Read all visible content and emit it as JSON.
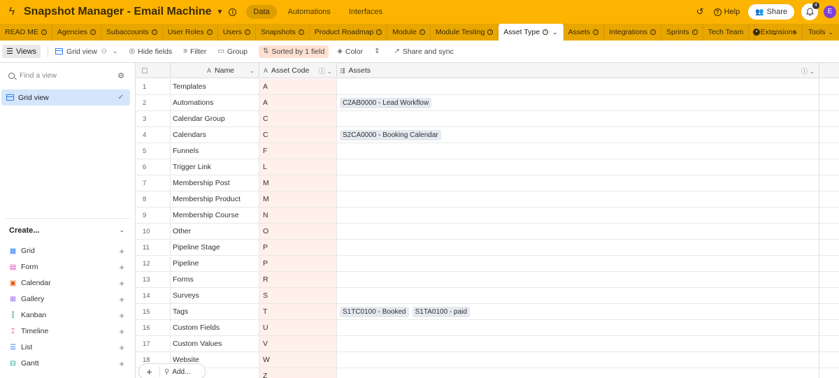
{
  "header": {
    "title": "Snapshot Manager - Email Machine",
    "nav": [
      "Data",
      "Automations",
      "Interfaces"
    ],
    "help_label": "Help",
    "share_label": "Share",
    "notification_count": "4",
    "avatar_initial": "E",
    "brand_color": "#fcb400"
  },
  "tabs": {
    "items": [
      "READ ME",
      "Agencies",
      "Subaccounts",
      "User Roles",
      "Users",
      "Snapshots",
      "Product Roadmap",
      "Module",
      "Module Testing",
      "Asset Type",
      "Assets",
      "Integrations",
      "Sprints",
      "Tech Team"
    ],
    "active": "Asset Type",
    "extensions_label": "Extensions",
    "tools_label": "Tools"
  },
  "toolbar": {
    "views_label": "Views",
    "grid_view_label": "Grid view",
    "hide_fields_label": "Hide fields",
    "filter_label": "Filter",
    "group_label": "Group",
    "sorted_label": "Sorted by 1 field",
    "color_label": "Color",
    "share_sync_label": "Share and sync"
  },
  "sidebar": {
    "find_placeholder": "Find a view",
    "active_view": "Grid view",
    "create_label": "Create...",
    "create_items": [
      "Grid",
      "Form",
      "Calendar",
      "Gallery",
      "Kanban",
      "Timeline",
      "List",
      "Gantt"
    ]
  },
  "grid": {
    "columns": [
      "Name",
      "Asset Code",
      "Assets"
    ],
    "rows": [
      {
        "num": "1",
        "name": "Templates",
        "code": "A",
        "assets": []
      },
      {
        "num": "2",
        "name": "Automations",
        "code": "A",
        "assets": [
          "C2AB0000 - Lead Workflow"
        ]
      },
      {
        "num": "3",
        "name": "Calendar Group",
        "code": "C",
        "assets": []
      },
      {
        "num": "4",
        "name": "Calendars",
        "code": "C",
        "assets": [
          "S2CA0000 - Booking Calendar"
        ]
      },
      {
        "num": "5",
        "name": "Funnels",
        "code": "F",
        "assets": []
      },
      {
        "num": "6",
        "name": "Trigger Link",
        "code": "L",
        "assets": []
      },
      {
        "num": "7",
        "name": "Membership Post",
        "code": "M",
        "assets": []
      },
      {
        "num": "8",
        "name": "Membership Product",
        "code": "M",
        "assets": []
      },
      {
        "num": "9",
        "name": "Membership Course",
        "code": "N",
        "assets": []
      },
      {
        "num": "10",
        "name": "Other",
        "code": "O",
        "assets": []
      },
      {
        "num": "11",
        "name": "Pipeline Stage",
        "code": "P",
        "assets": []
      },
      {
        "num": "12",
        "name": "Pipeline",
        "code": "P",
        "assets": []
      },
      {
        "num": "13",
        "name": "Forms",
        "code": "R",
        "assets": []
      },
      {
        "num": "14",
        "name": "Surveys",
        "code": "S",
        "assets": []
      },
      {
        "num": "15",
        "name": "Tags",
        "code": "T",
        "assets": [
          "S1TC0100 - Booked",
          "S1TA0100 - paid"
        ]
      },
      {
        "num": "16",
        "name": "Custom Fields",
        "code": "U",
        "assets": []
      },
      {
        "num": "17",
        "name": "Custom Values",
        "code": "V",
        "assets": []
      },
      {
        "num": "18",
        "name": "Website",
        "code": "W",
        "assets": []
      },
      {
        "num": "",
        "name": "eference",
        "code": "Z",
        "assets": []
      }
    ],
    "add_label": "Add..."
  }
}
